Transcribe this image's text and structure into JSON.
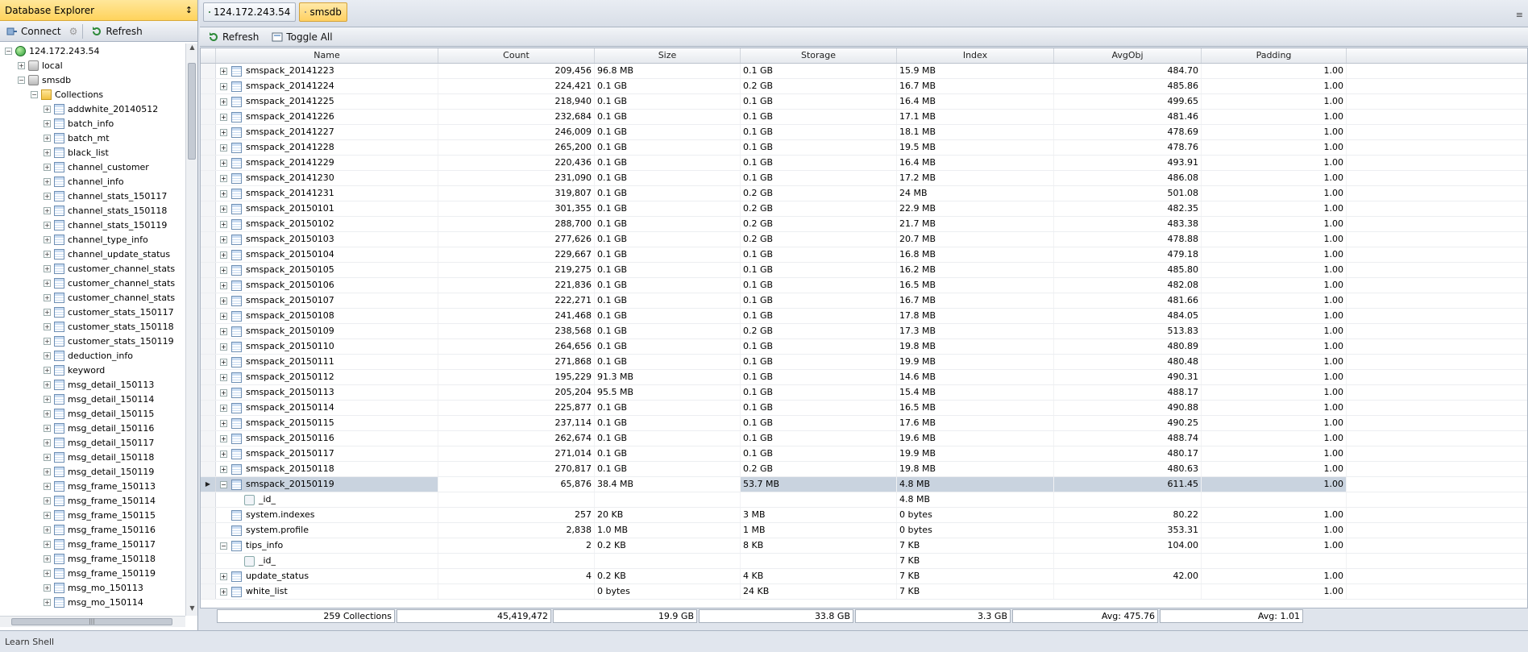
{
  "explorer": {
    "title": "Database Explorer",
    "pin_glyph": "↕",
    "connect_label": "Connect",
    "refresh_label": "Refresh",
    "tree": [
      {
        "level": 0,
        "exp": "−",
        "icon": "server",
        "label": "124.172.243.54"
      },
      {
        "level": 1,
        "exp": "+",
        "icon": "db",
        "label": "local"
      },
      {
        "level": 1,
        "exp": "−",
        "icon": "db",
        "label": "smsdb"
      },
      {
        "level": 2,
        "exp": "−",
        "icon": "folder",
        "label": "Collections"
      },
      {
        "level": 3,
        "exp": "+",
        "icon": "table",
        "label": "addwhite_20140512"
      },
      {
        "level": 3,
        "exp": "+",
        "icon": "table",
        "label": "batch_info"
      },
      {
        "level": 3,
        "exp": "+",
        "icon": "table",
        "label": "batch_mt"
      },
      {
        "level": 3,
        "exp": "+",
        "icon": "table",
        "label": "black_list"
      },
      {
        "level": 3,
        "exp": "+",
        "icon": "table",
        "label": "channel_customer"
      },
      {
        "level": 3,
        "exp": "+",
        "icon": "table",
        "label": "channel_info"
      },
      {
        "level": 3,
        "exp": "+",
        "icon": "table",
        "label": "channel_stats_150117"
      },
      {
        "level": 3,
        "exp": "+",
        "icon": "table",
        "label": "channel_stats_150118"
      },
      {
        "level": 3,
        "exp": "+",
        "icon": "table",
        "label": "channel_stats_150119"
      },
      {
        "level": 3,
        "exp": "+",
        "icon": "table",
        "label": "channel_type_info"
      },
      {
        "level": 3,
        "exp": "+",
        "icon": "table",
        "label": "channel_update_status"
      },
      {
        "level": 3,
        "exp": "+",
        "icon": "table",
        "label": "customer_channel_stats"
      },
      {
        "level": 3,
        "exp": "+",
        "icon": "table",
        "label": "customer_channel_stats"
      },
      {
        "level": 3,
        "exp": "+",
        "icon": "table",
        "label": "customer_channel_stats"
      },
      {
        "level": 3,
        "exp": "+",
        "icon": "table",
        "label": "customer_stats_150117"
      },
      {
        "level": 3,
        "exp": "+",
        "icon": "table",
        "label": "customer_stats_150118"
      },
      {
        "level": 3,
        "exp": "+",
        "icon": "table",
        "label": "customer_stats_150119"
      },
      {
        "level": 3,
        "exp": "+",
        "icon": "table",
        "label": "deduction_info"
      },
      {
        "level": 3,
        "exp": "+",
        "icon": "table",
        "label": "keyword"
      },
      {
        "level": 3,
        "exp": "+",
        "icon": "table",
        "label": "msg_detail_150113"
      },
      {
        "level": 3,
        "exp": "+",
        "icon": "table",
        "label": "msg_detail_150114"
      },
      {
        "level": 3,
        "exp": "+",
        "icon": "table",
        "label": "msg_detail_150115"
      },
      {
        "level": 3,
        "exp": "+",
        "icon": "table",
        "label": "msg_detail_150116"
      },
      {
        "level": 3,
        "exp": "+",
        "icon": "table",
        "label": "msg_detail_150117"
      },
      {
        "level": 3,
        "exp": "+",
        "icon": "table",
        "label": "msg_detail_150118"
      },
      {
        "level": 3,
        "exp": "+",
        "icon": "table",
        "label": "msg_detail_150119"
      },
      {
        "level": 3,
        "exp": "+",
        "icon": "table",
        "label": "msg_frame_150113"
      },
      {
        "level": 3,
        "exp": "+",
        "icon": "table",
        "label": "msg_frame_150114"
      },
      {
        "level": 3,
        "exp": "+",
        "icon": "table",
        "label": "msg_frame_150115"
      },
      {
        "level": 3,
        "exp": "+",
        "icon": "table",
        "label": "msg_frame_150116"
      },
      {
        "level": 3,
        "exp": "+",
        "icon": "table",
        "label": "msg_frame_150117"
      },
      {
        "level": 3,
        "exp": "+",
        "icon": "table",
        "label": "msg_frame_150118"
      },
      {
        "level": 3,
        "exp": "+",
        "icon": "table",
        "label": "msg_frame_150119"
      },
      {
        "level": 3,
        "exp": "+",
        "icon": "table",
        "label": "msg_mo_150113"
      },
      {
        "level": 3,
        "exp": "+",
        "icon": "table",
        "label": "msg_mo_150114"
      }
    ]
  },
  "tabs": [
    {
      "label": "124.172.243.54",
      "icon": "server",
      "active": false
    },
    {
      "label": "smsdb",
      "icon": "db",
      "active": true
    }
  ],
  "tab_menu_glyph": "≡",
  "toolbar": {
    "refresh_label": "Refresh",
    "toggle_label": "Toggle All"
  },
  "grid": {
    "columns": [
      "Name",
      "Count",
      "Size",
      "Storage",
      "Index",
      "AvgObj",
      "Padding"
    ],
    "rows": [
      {
        "exp": "+",
        "icon": "table",
        "indent": 0,
        "name": "smspack_20141223",
        "count": "209,456",
        "size": "96.8 MB",
        "storage": "0.1 GB",
        "index": "15.9 MB",
        "avg": "484.70",
        "pad": "1.00"
      },
      {
        "exp": "+",
        "icon": "table",
        "indent": 0,
        "name": "smspack_20141224",
        "count": "224,421",
        "size": "0.1 GB",
        "storage": "0.2 GB",
        "index": "16.7 MB",
        "avg": "485.86",
        "pad": "1.00"
      },
      {
        "exp": "+",
        "icon": "table",
        "indent": 0,
        "name": "smspack_20141225",
        "count": "218,940",
        "size": "0.1 GB",
        "storage": "0.1 GB",
        "index": "16.4 MB",
        "avg": "499.65",
        "pad": "1.00"
      },
      {
        "exp": "+",
        "icon": "table",
        "indent": 0,
        "name": "smspack_20141226",
        "count": "232,684",
        "size": "0.1 GB",
        "storage": "0.1 GB",
        "index": "17.1 MB",
        "avg": "481.46",
        "pad": "1.00"
      },
      {
        "exp": "+",
        "icon": "table",
        "indent": 0,
        "name": "smspack_20141227",
        "count": "246,009",
        "size": "0.1 GB",
        "storage": "0.1 GB",
        "index": "18.1 MB",
        "avg": "478.69",
        "pad": "1.00"
      },
      {
        "exp": "+",
        "icon": "table",
        "indent": 0,
        "name": "smspack_20141228",
        "count": "265,200",
        "size": "0.1 GB",
        "storage": "0.1 GB",
        "index": "19.5 MB",
        "avg": "478.76",
        "pad": "1.00"
      },
      {
        "exp": "+",
        "icon": "table",
        "indent": 0,
        "name": "smspack_20141229",
        "count": "220,436",
        "size": "0.1 GB",
        "storage": "0.1 GB",
        "index": "16.4 MB",
        "avg": "493.91",
        "pad": "1.00"
      },
      {
        "exp": "+",
        "icon": "table",
        "indent": 0,
        "name": "smspack_20141230",
        "count": "231,090",
        "size": "0.1 GB",
        "storage": "0.1 GB",
        "index": "17.2 MB",
        "avg": "486.08",
        "pad": "1.00"
      },
      {
        "exp": "+",
        "icon": "table",
        "indent": 0,
        "name": "smspack_20141231",
        "count": "319,807",
        "size": "0.1 GB",
        "storage": "0.2 GB",
        "index": "24 MB",
        "avg": "501.08",
        "pad": "1.00"
      },
      {
        "exp": "+",
        "icon": "table",
        "indent": 0,
        "name": "smspack_20150101",
        "count": "301,355",
        "size": "0.1 GB",
        "storage": "0.2 GB",
        "index": "22.9 MB",
        "avg": "482.35",
        "pad": "1.00"
      },
      {
        "exp": "+",
        "icon": "table",
        "indent": 0,
        "name": "smspack_20150102",
        "count": "288,700",
        "size": "0.1 GB",
        "storage": "0.2 GB",
        "index": "21.7 MB",
        "avg": "483.38",
        "pad": "1.00"
      },
      {
        "exp": "+",
        "icon": "table",
        "indent": 0,
        "name": "smspack_20150103",
        "count": "277,626",
        "size": "0.1 GB",
        "storage": "0.2 GB",
        "index": "20.7 MB",
        "avg": "478.88",
        "pad": "1.00"
      },
      {
        "exp": "+",
        "icon": "table",
        "indent": 0,
        "name": "smspack_20150104",
        "count": "229,667",
        "size": "0.1 GB",
        "storage": "0.1 GB",
        "index": "16.8 MB",
        "avg": "479.18",
        "pad": "1.00"
      },
      {
        "exp": "+",
        "icon": "table",
        "indent": 0,
        "name": "smspack_20150105",
        "count": "219,275",
        "size": "0.1 GB",
        "storage": "0.1 GB",
        "index": "16.2 MB",
        "avg": "485.80",
        "pad": "1.00"
      },
      {
        "exp": "+",
        "icon": "table",
        "indent": 0,
        "name": "smspack_20150106",
        "count": "221,836",
        "size": "0.1 GB",
        "storage": "0.1 GB",
        "index": "16.5 MB",
        "avg": "482.08",
        "pad": "1.00"
      },
      {
        "exp": "+",
        "icon": "table",
        "indent": 0,
        "name": "smspack_20150107",
        "count": "222,271",
        "size": "0.1 GB",
        "storage": "0.1 GB",
        "index": "16.7 MB",
        "avg": "481.66",
        "pad": "1.00"
      },
      {
        "exp": "+",
        "icon": "table",
        "indent": 0,
        "name": "smspack_20150108",
        "count": "241,468",
        "size": "0.1 GB",
        "storage": "0.1 GB",
        "index": "17.8 MB",
        "avg": "484.05",
        "pad": "1.00"
      },
      {
        "exp": "+",
        "icon": "table",
        "indent": 0,
        "name": "smspack_20150109",
        "count": "238,568",
        "size": "0.1 GB",
        "storage": "0.2 GB",
        "index": "17.3 MB",
        "avg": "513.83",
        "pad": "1.00"
      },
      {
        "exp": "+",
        "icon": "table",
        "indent": 0,
        "name": "smspack_20150110",
        "count": "264,656",
        "size": "0.1 GB",
        "storage": "0.1 GB",
        "index": "19.8 MB",
        "avg": "480.89",
        "pad": "1.00"
      },
      {
        "exp": "+",
        "icon": "table",
        "indent": 0,
        "name": "smspack_20150111",
        "count": "271,868",
        "size": "0.1 GB",
        "storage": "0.1 GB",
        "index": "19.9 MB",
        "avg": "480.48",
        "pad": "1.00"
      },
      {
        "exp": "+",
        "icon": "table",
        "indent": 0,
        "name": "smspack_20150112",
        "count": "195,229",
        "size": "91.3 MB",
        "storage": "0.1 GB",
        "index": "14.6 MB",
        "avg": "490.31",
        "pad": "1.00"
      },
      {
        "exp": "+",
        "icon": "table",
        "indent": 0,
        "name": "smspack_20150113",
        "count": "205,204",
        "size": "95.5 MB",
        "storage": "0.1 GB",
        "index": "15.4 MB",
        "avg": "488.17",
        "pad": "1.00"
      },
      {
        "exp": "+",
        "icon": "table",
        "indent": 0,
        "name": "smspack_20150114",
        "count": "225,877",
        "size": "0.1 GB",
        "storage": "0.1 GB",
        "index": "16.5 MB",
        "avg": "490.88",
        "pad": "1.00"
      },
      {
        "exp": "+",
        "icon": "table",
        "indent": 0,
        "name": "smspack_20150115",
        "count": "237,114",
        "size": "0.1 GB",
        "storage": "0.1 GB",
        "index": "17.6 MB",
        "avg": "490.25",
        "pad": "1.00"
      },
      {
        "exp": "+",
        "icon": "table",
        "indent": 0,
        "name": "smspack_20150116",
        "count": "262,674",
        "size": "0.1 GB",
        "storage": "0.1 GB",
        "index": "19.6 MB",
        "avg": "488.74",
        "pad": "1.00"
      },
      {
        "exp": "+",
        "icon": "table",
        "indent": 0,
        "name": "smspack_20150117",
        "count": "271,014",
        "size": "0.1 GB",
        "storage": "0.1 GB",
        "index": "19.9 MB",
        "avg": "480.17",
        "pad": "1.00"
      },
      {
        "exp": "+",
        "icon": "table",
        "indent": 0,
        "name": "smspack_20150118",
        "count": "270,817",
        "size": "0.1 GB",
        "storage": "0.2 GB",
        "index": "19.8 MB",
        "avg": "480.63",
        "pad": "1.00"
      },
      {
        "exp": "−",
        "icon": "table",
        "indent": 0,
        "name": "smspack_20150119",
        "count": "65,876",
        "size": "38.4 MB",
        "storage": "53.7 MB",
        "index": "4.8 MB",
        "avg": "611.45",
        "pad": "1.00",
        "selected": true
      },
      {
        "exp": "",
        "icon": "key",
        "indent": 1,
        "name": "_id_",
        "count": "",
        "size": "",
        "storage": "",
        "index": "4.8 MB",
        "avg": "",
        "pad": ""
      },
      {
        "exp": "",
        "icon": "table",
        "indent": 0,
        "name": "system.indexes",
        "count": "257",
        "size": "20 KB",
        "storage": "3 MB",
        "index": "0 bytes",
        "avg": "80.22",
        "pad": "1.00"
      },
      {
        "exp": "",
        "icon": "table",
        "indent": 0,
        "name": "system.profile",
        "count": "2,838",
        "size": "1.0 MB",
        "storage": "1 MB",
        "index": "0 bytes",
        "avg": "353.31",
        "pad": "1.00"
      },
      {
        "exp": "−",
        "icon": "table",
        "indent": 0,
        "name": "tips_info",
        "count": "2",
        "size": "0.2 KB",
        "storage": "8 KB",
        "index": "7 KB",
        "avg": "104.00",
        "pad": "1.00"
      },
      {
        "exp": "",
        "icon": "key",
        "indent": 1,
        "name": "_id_",
        "count": "",
        "size": "",
        "storage": "",
        "index": "7 KB",
        "avg": "",
        "pad": ""
      },
      {
        "exp": "+",
        "icon": "table",
        "indent": 0,
        "name": "update_status",
        "count": "4",
        "size": "0.2 KB",
        "storage": "4 KB",
        "index": "7 KB",
        "avg": "42.00",
        "pad": "1.00"
      },
      {
        "exp": "+",
        "icon": "table",
        "indent": 0,
        "name": "white_list",
        "count": "",
        "size": "0 bytes",
        "storage": "24 KB",
        "index": "7 KB",
        "avg": "",
        "pad": "1.00"
      }
    ],
    "selected_marker": "▶",
    "totals": {
      "name": "259 Collections",
      "count": "45,419,472",
      "size": "19.9 GB",
      "storage": "33.8 GB",
      "index": "3.3 GB",
      "avg": "Avg: 475.76",
      "pad": "Avg: 1.01"
    }
  },
  "status_bar": {
    "text": "Learn Shell"
  }
}
